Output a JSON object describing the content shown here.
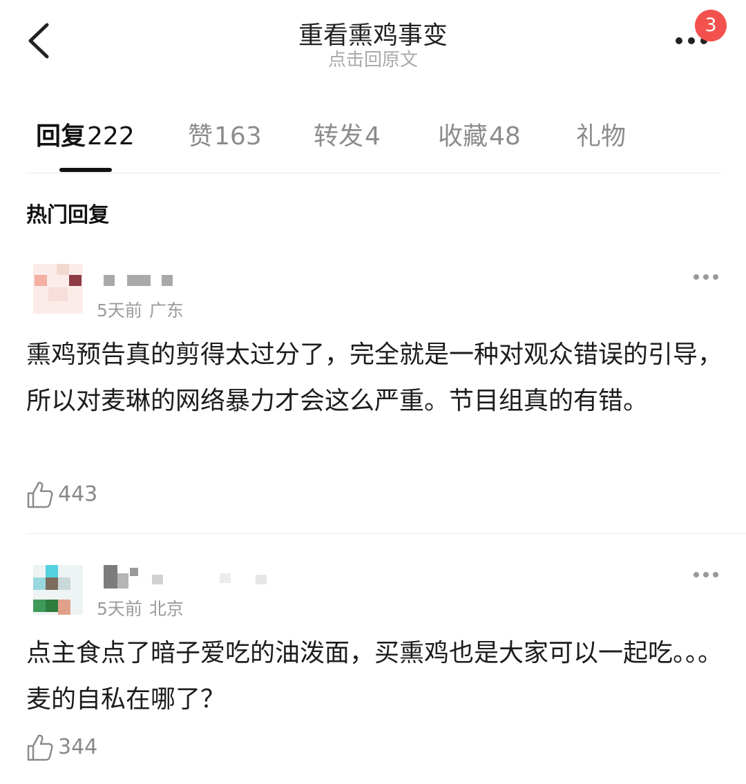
{
  "header": {
    "title": "重看熏鸡事变",
    "subtitle": "点击回原文",
    "back_icon": "chevron-left-icon",
    "more_icon": "more-horizontal-icon",
    "notification_badge": "3",
    "badge_color": "#f2514d"
  },
  "tabs": [
    {
      "label": "回复",
      "count": "222",
      "active": true
    },
    {
      "label": "赞",
      "count": "163",
      "active": false
    },
    {
      "label": "转发",
      "count": "4",
      "active": false
    },
    {
      "label": "收藏",
      "count": "48",
      "active": false
    },
    {
      "label": "礼物",
      "count": "",
      "active": false
    }
  ],
  "section_title": "热门回复",
  "comments": [
    {
      "time": "5天前",
      "location": "广东",
      "text": "熏鸡预告真的剪得太过分了，完全就是一种对观众错误的引导，所以对麦琳的网络暴力才会这么严重。节目组真的有错。",
      "likes": "443"
    },
    {
      "time": "5天前",
      "location": "北京",
      "text": "点主食点了暗子爱吃的油泼面，买熏鸡也是大家可以一起吃。。。麦的自私在哪了？",
      "likes": "344"
    }
  ]
}
